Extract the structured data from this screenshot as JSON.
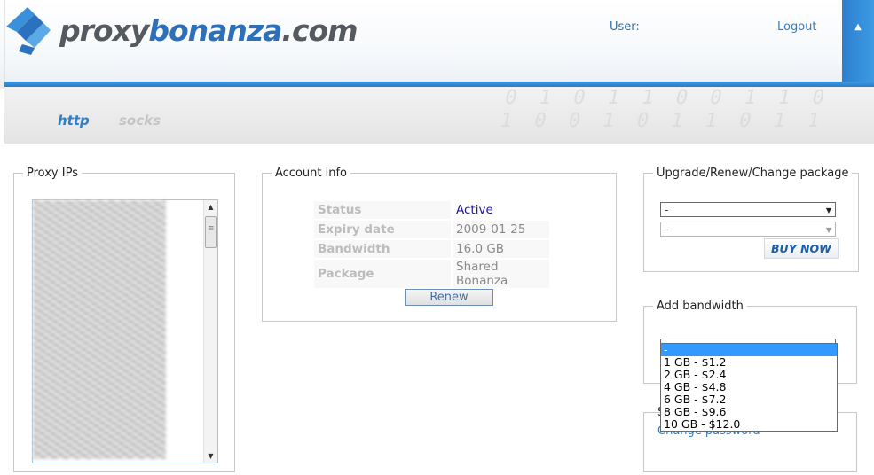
{
  "header": {
    "logo": {
      "part1": "proxy",
      "part2": "bonanza",
      "part3": ".com"
    },
    "user_label": "User:",
    "logout_label": "Logout",
    "scroll_top_icon": "▲"
  },
  "nav": {
    "tabs": [
      {
        "label": "http",
        "active": true
      },
      {
        "label": "socks",
        "active": false
      }
    ],
    "background_bits": "0 1 0 1 1 0 0 1 1 0\n1 0 0 1 0 1 1 0 1 1"
  },
  "proxy_ips": {
    "legend": "Proxy IPs"
  },
  "account_info": {
    "legend": "Account info",
    "rows": [
      {
        "key": "Status",
        "value": "Active"
      },
      {
        "key": "Expiry date",
        "value": "2009-01-25"
      },
      {
        "key": "Bandwidth",
        "value": "16.0 GB"
      },
      {
        "key": "Package",
        "value": "Shared Bonanza"
      }
    ],
    "renew_label": "Renew"
  },
  "upgrade": {
    "legend": "Upgrade/Renew/Change package",
    "select1_value": "-",
    "select2_value": "-",
    "buy_now_label": "BUY NOW"
  },
  "add_bandwidth": {
    "legend": "Add bandwidth",
    "select_value": "-",
    "options": [
      "-",
      "1 GB - $1.2",
      "2 GB - $2.4",
      "4 GB - $4.8",
      "6 GB - $7.2",
      "8 GB - $9.6",
      "10 GB - $12.0"
    ]
  },
  "settings": {
    "partial_legend": "S",
    "change_password_label": "Change password"
  },
  "colors": {
    "accent": "#2f7fc8",
    "selected_option": "#3399ff"
  }
}
